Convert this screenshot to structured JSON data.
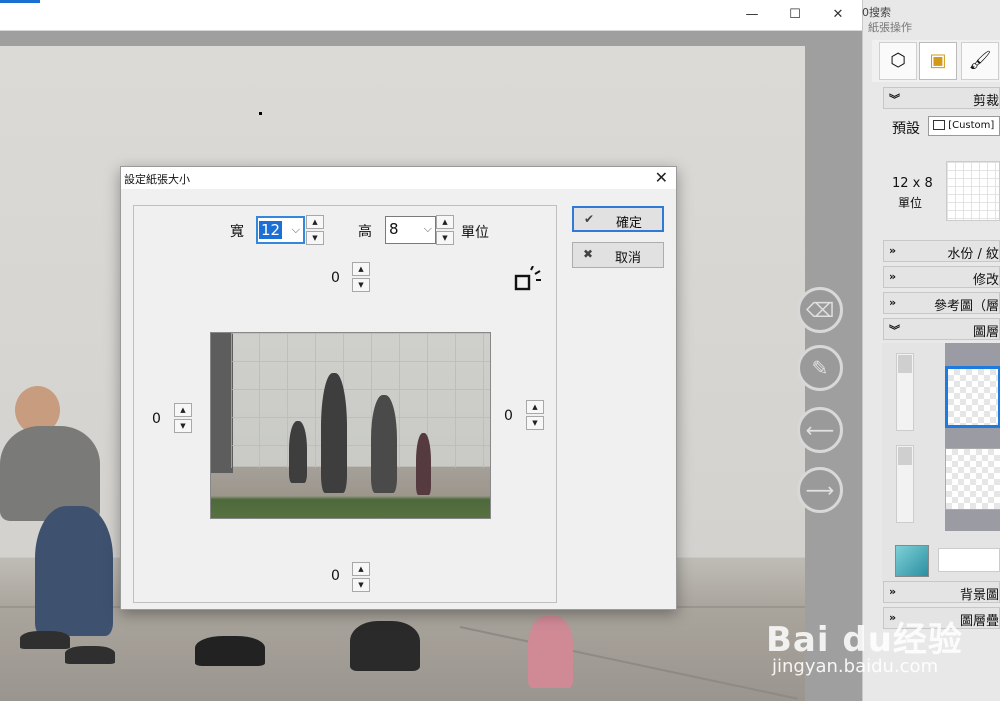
{
  "window": {
    "minimize_glyph": "—",
    "maximize_glyph": "☐",
    "close_glyph": "✕",
    "side_tab_text": "0搜索"
  },
  "panel": {
    "title": "紙張操作",
    "tabs": [
      {
        "icon": "paper-icon",
        "glyph": "⬡"
      },
      {
        "icon": "canvas-size-icon",
        "glyph": "▣"
      },
      {
        "icon": "brush-icon",
        "glyph": "🖌"
      }
    ],
    "sections": {
      "crop": "剪裁",
      "watermark": "水份 / 紋",
      "modify": "修改",
      "reference": "參考圖（層",
      "layers": "圖層",
      "background": "背景圖",
      "layer_blend": "圖層疊"
    },
    "preset_label": "預設",
    "preset_value": "[Custom]",
    "size_text": "12 x 8",
    "unit_text": "單位"
  },
  "dialog": {
    "title": "設定紙張大小",
    "close_glyph": "✕",
    "width_label": "寬",
    "width_value": "12",
    "height_label": "高",
    "height_value": "8",
    "unit_label": "單位",
    "top_margin": "0",
    "left_margin": "0",
    "right_margin": "0",
    "bottom_margin": "0",
    "ok_label": "確定",
    "ok_icon": "✔",
    "cancel_label": "取消",
    "cancel_icon": "✖"
  },
  "watermark": {
    "brand": "Bai du经验",
    "url": "jingyan.baidu.com"
  },
  "colors": {
    "accent": "#2f7ad6",
    "highlight": "#1c6fd4"
  }
}
